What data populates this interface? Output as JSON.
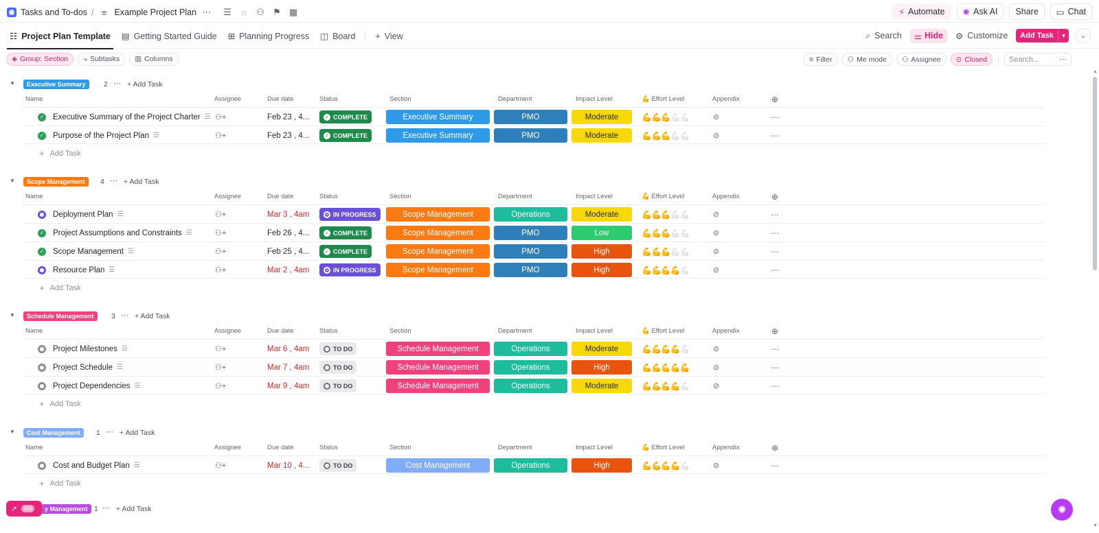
{
  "topbar": {
    "breadcrumb_space": "Tasks and To-dos",
    "breadcrumb_sep": "/",
    "breadcrumb_list": "Example Project Plan",
    "automate": "Automate",
    "ask_ai": "Ask AI",
    "share": "Share",
    "chat": "Chat"
  },
  "tabs": {
    "items": [
      "Project Plan Template",
      "Getting Started Guide",
      "Planning Progress",
      "Board"
    ],
    "add_view": "View",
    "search": "Search",
    "hide": "Hide",
    "customize": "Customize",
    "add_task": "Add Task"
  },
  "filters": {
    "group": "Group: Section",
    "subtasks": "Subtasks",
    "columns": "Columns",
    "filter": "Filter",
    "me_mode": "Me mode",
    "assignee": "Assignee",
    "closed": "Closed",
    "search_placeholder": "Search..."
  },
  "columns": {
    "name": "Name",
    "assignee": "Assignee",
    "due": "Due date",
    "status": "Status",
    "section": "Section",
    "department": "Department",
    "impact": "Impact Level",
    "effort": "💪 Effort Level",
    "appendix": "Appendix"
  },
  "add_task_label": "Add Task",
  "groups": [
    {
      "name": "Executive Summary",
      "count": "2",
      "color": "#2f9be8",
      "tasks": [
        {
          "name": "Executive Summary of the Project Charter",
          "due": "Feb 23 , 4...",
          "late": false,
          "status": "COMPLETE",
          "section": "Executive Summary",
          "dept": "PMO",
          "impact": "Moderate",
          "effort": 3
        },
        {
          "name": "Purpose of the Project Plan",
          "due": "Feb 23 , 4...",
          "late": false,
          "status": "COMPLETE",
          "section": "Executive Summary",
          "dept": "PMO",
          "impact": "Moderate",
          "effort": 3
        }
      ]
    },
    {
      "name": "Scope Management",
      "count": "4",
      "color": "#fb7a12",
      "tasks": [
        {
          "name": "Deployment Plan",
          "due": "Mar 3 , 4am",
          "late": true,
          "status": "IN PROGRESS",
          "section": "Scope Management",
          "dept": "Operations",
          "impact": "Moderate",
          "effort": 3
        },
        {
          "name": "Project Assumptions and Constraints",
          "due": "Feb 26 , 4...",
          "late": false,
          "status": "COMPLETE",
          "section": "Scope Management",
          "dept": "PMO",
          "impact": "Low",
          "effort": 3
        },
        {
          "name": "Scope Management",
          "due": "Feb 25 , 4...",
          "late": false,
          "status": "COMPLETE",
          "section": "Scope Management",
          "dept": "PMO",
          "impact": "High",
          "effort": 3
        },
        {
          "name": "Resource Plan",
          "due": "Mar 2 , 4am",
          "late": true,
          "status": "IN PROGRESS",
          "section": "Scope Management",
          "dept": "PMO",
          "impact": "High",
          "effort": 4
        }
      ]
    },
    {
      "name": "Schedule Management",
      "count": "3",
      "color": "#f0417c",
      "tasks": [
        {
          "name": "Project Milestones",
          "due": "Mar 6 , 4am",
          "late": true,
          "status": "TO DO",
          "section": "Schedule Management",
          "dept": "Operations",
          "impact": "Moderate",
          "effort": 4
        },
        {
          "name": "Project Schedule",
          "due": "Mar 7 , 4am",
          "late": true,
          "status": "TO DO",
          "section": "Schedule Management",
          "dept": "Operations",
          "impact": "High",
          "effort": 5
        },
        {
          "name": "Project Dependencies",
          "due": "Mar 9 , 4am",
          "late": true,
          "status": "TO DO",
          "section": "Schedule Management",
          "dept": "Operations",
          "impact": "Moderate",
          "effort": 4
        }
      ]
    },
    {
      "name": "Cost Management",
      "count": "1",
      "color": "#81acf7",
      "tasks": [
        {
          "name": "Cost and Budget Plan",
          "due": "Mar 10 , 4...",
          "late": true,
          "status": "TO DO",
          "section": "Cost Management",
          "dept": "Operations",
          "impact": "High",
          "effort": 4
        }
      ]
    }
  ],
  "partial_group": {
    "name": "y Management",
    "count": "1",
    "color": "#b64ce0"
  },
  "colors": {
    "pmo": "#2f7fba",
    "operations": "#1cbc9c",
    "moderate": "#f7d90a",
    "low": "#2ecc71",
    "high": "#e8540d",
    "accent": "#e5247a"
  },
  "rocket_count": "0/4"
}
